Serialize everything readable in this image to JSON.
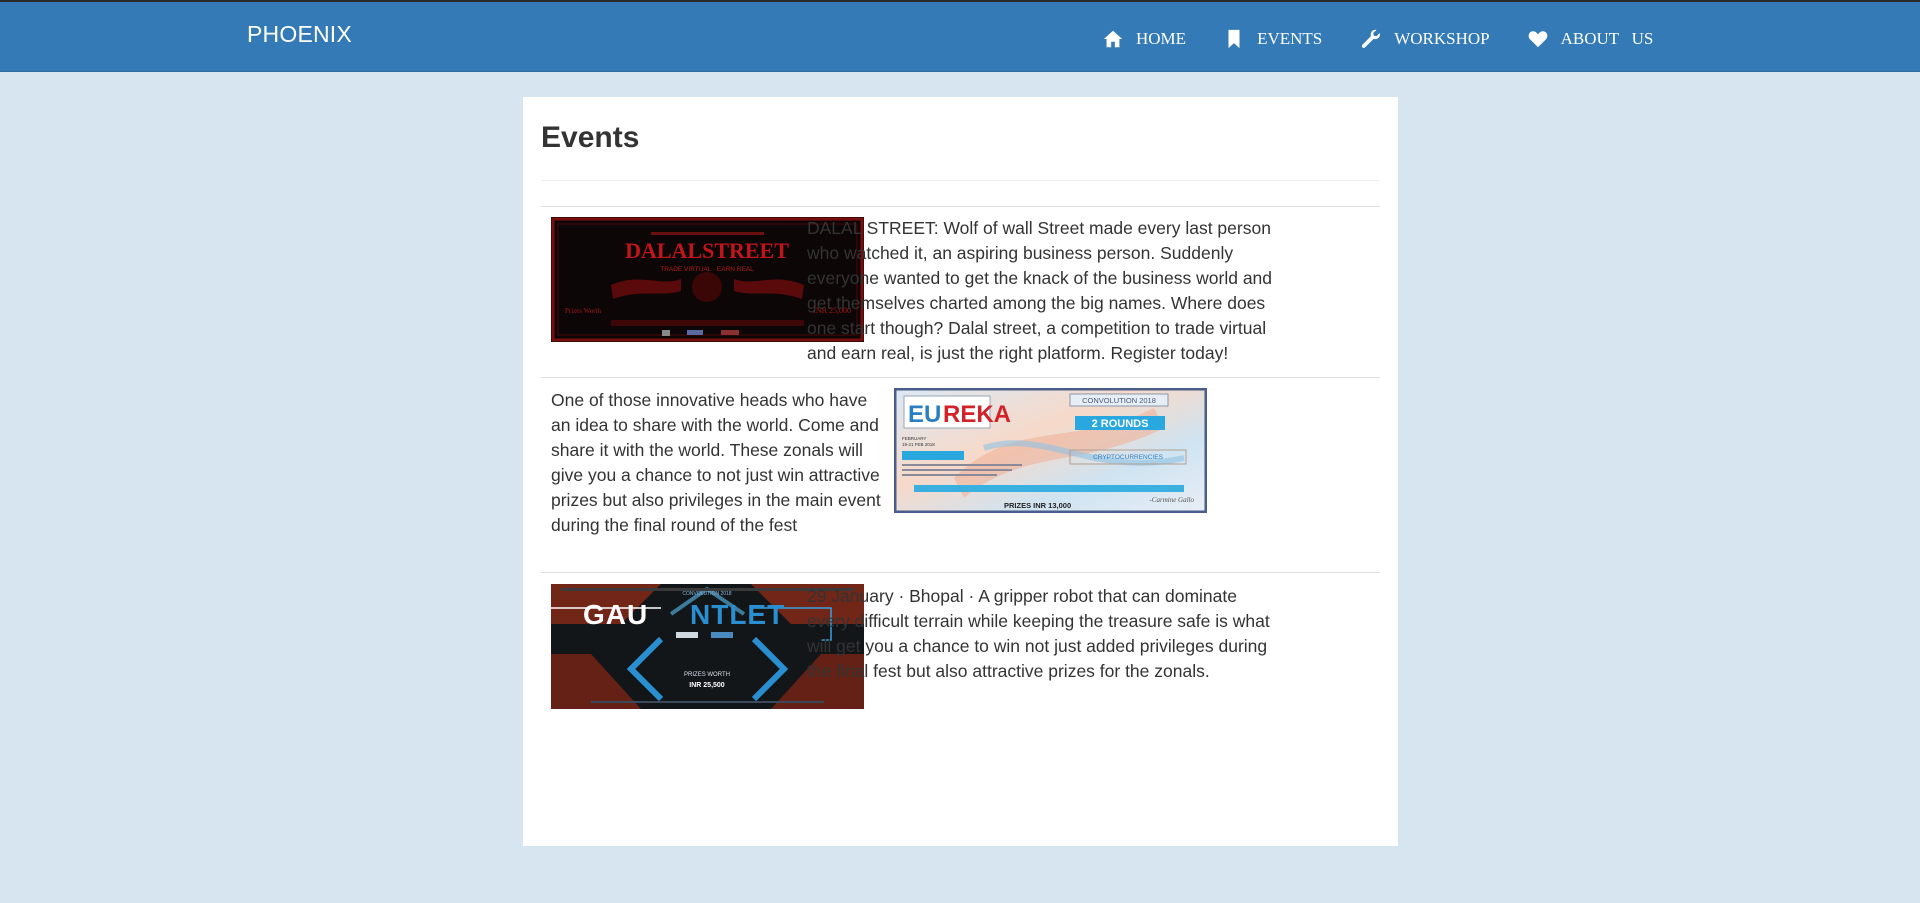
{
  "navbar": {
    "brand": "PHOENIX",
    "items": [
      {
        "label": "HOME",
        "icon": "home-icon"
      },
      {
        "label": "EVENTS",
        "icon": "bookmark-icon"
      },
      {
        "label": "WORKSHOP",
        "icon": "wrench-icon"
      },
      {
        "label": "ABOUT   US",
        "icon": "heart-icon"
      }
    ],
    "color": "#337ab7"
  },
  "page": {
    "title": "Events",
    "background": "#d7e5f0"
  },
  "events": [
    {
      "poster": {
        "title": "DALALSTREET",
        "subtitle": "TRADE VIRTUAL · EARN REAL",
        "prize_label": "Prizes Worth",
        "prize": "INR 25,000"
      },
      "description": "DALAL STREET: Wolf of wall Street made every last person who watched it, an aspiring business person. Suddenly everyone wanted to get the knack of the business world and get themselves charted among the big names. Where does one start though? Dalal street, a competition to trade virtual and earn real, is just the right platform. Register today!"
    },
    {
      "poster": {
        "title_a": "EU",
        "title_b": "REKA",
        "badge": "CONVOLUTION 2018",
        "rounds": "2 ROUNDS",
        "date": "FEBRUARY",
        "dates": "19-21 FEB 2018",
        "topic": "CRYPTOCURRENCIES",
        "quote_author": "-Carmine Gallo",
        "prize": "PRIZES   INR 13,000"
      },
      "description": "One of those innovative heads who have an idea to share with the world. Come and share it with the world. These zonals will give you a chance to not just win attractive prizes but also privileges in the main event during the final round of the fest"
    },
    {
      "poster": {
        "title_a": "GAU",
        "title_b": "NTLET",
        "badge": "CONVOLUTION 2018",
        "prize_label": "PRIZES WORTH",
        "prize": "INR 25,500"
      },
      "description": "29 January · Bhopal · A gripper robot that can dominate every difficult terrain while keeping the treasure safe is what will get you a chance to win not just added privileges during the final fest but also attractive prizes for the zonals."
    }
  ]
}
